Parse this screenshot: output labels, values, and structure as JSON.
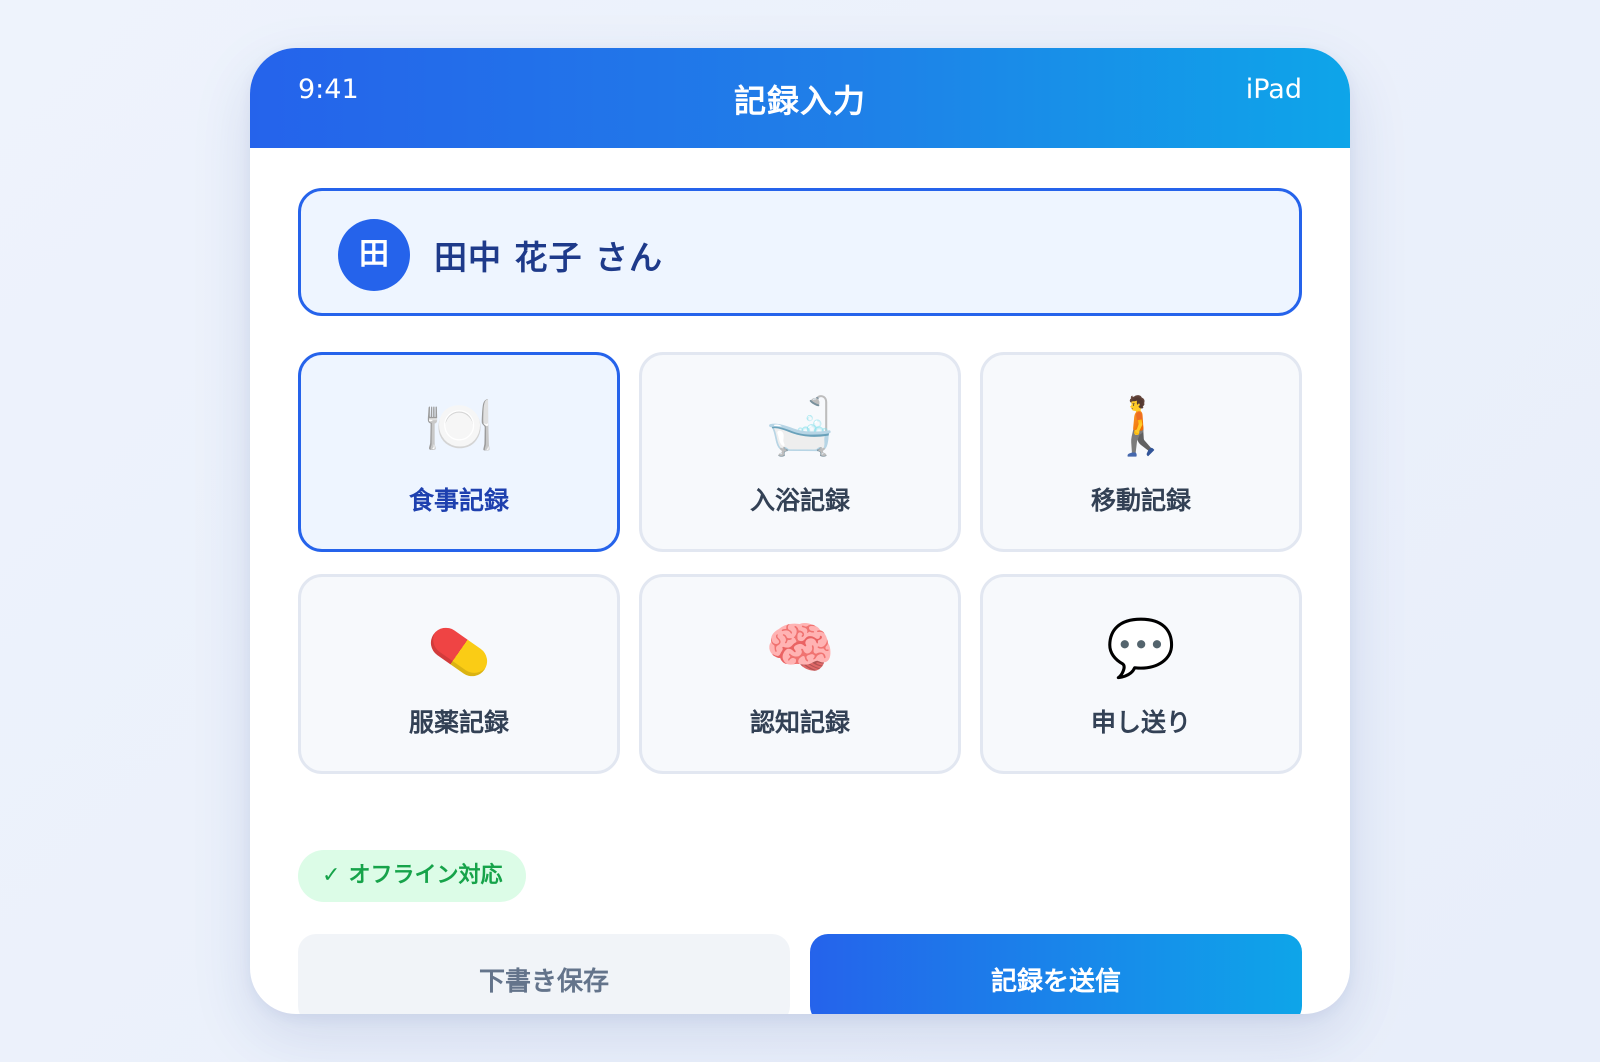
{
  "status_bar": {
    "time": "9:41",
    "title": "記録入力",
    "device": "iPad"
  },
  "patient": {
    "avatar_initial": "田",
    "name": "田中 花子 さん"
  },
  "categories": [
    {
      "label": "食事記録",
      "icon": "meal-icon",
      "glyph": "🍽️",
      "selected": true
    },
    {
      "label": "入浴記録",
      "icon": "bath-icon",
      "glyph": "🛁",
      "selected": false
    },
    {
      "label": "移動記録",
      "icon": "walking-person-icon",
      "glyph": "🚶",
      "selected": false
    },
    {
      "label": "服薬記録",
      "icon": "pill-icon",
      "glyph": "💊",
      "selected": false
    },
    {
      "label": "認知記録",
      "icon": "brain-icon",
      "glyph": "🧠",
      "selected": false
    },
    {
      "label": "申し送り",
      "icon": "speech-bubble-icon",
      "glyph": "💬",
      "selected": false
    }
  ],
  "offline_badge": {
    "check": "✓",
    "label": "オフライン対応"
  },
  "actions": {
    "draft_label": "下書き保存",
    "submit_label": "記録を送信"
  },
  "colors": {
    "accent": "#2563eb",
    "accent_end": "#0ea5e9",
    "selected_bg": "#eef5ff",
    "success": "#16a34a",
    "success_bg": "#dcfce7"
  }
}
